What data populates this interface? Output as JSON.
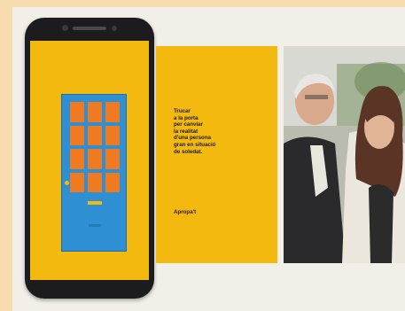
{
  "phone": {
    "screen_color": "#f4b90f",
    "door_color": "#2f8fd3",
    "pane_color": "#ef7a20",
    "panes": [
      "",
      "",
      "",
      "",
      "",
      "",
      "",
      "",
      "",
      "",
      "",
      ""
    ]
  },
  "card": {
    "message": "Trucar\na la porta\nper canviar\nla realitat\nd'una persona\ngran en situació\nde soledat.",
    "brand": "Apropa't"
  },
  "colors": {
    "frame": "#f7dcb0",
    "background": "#f2efe8",
    "accent": "#f4b90f"
  }
}
